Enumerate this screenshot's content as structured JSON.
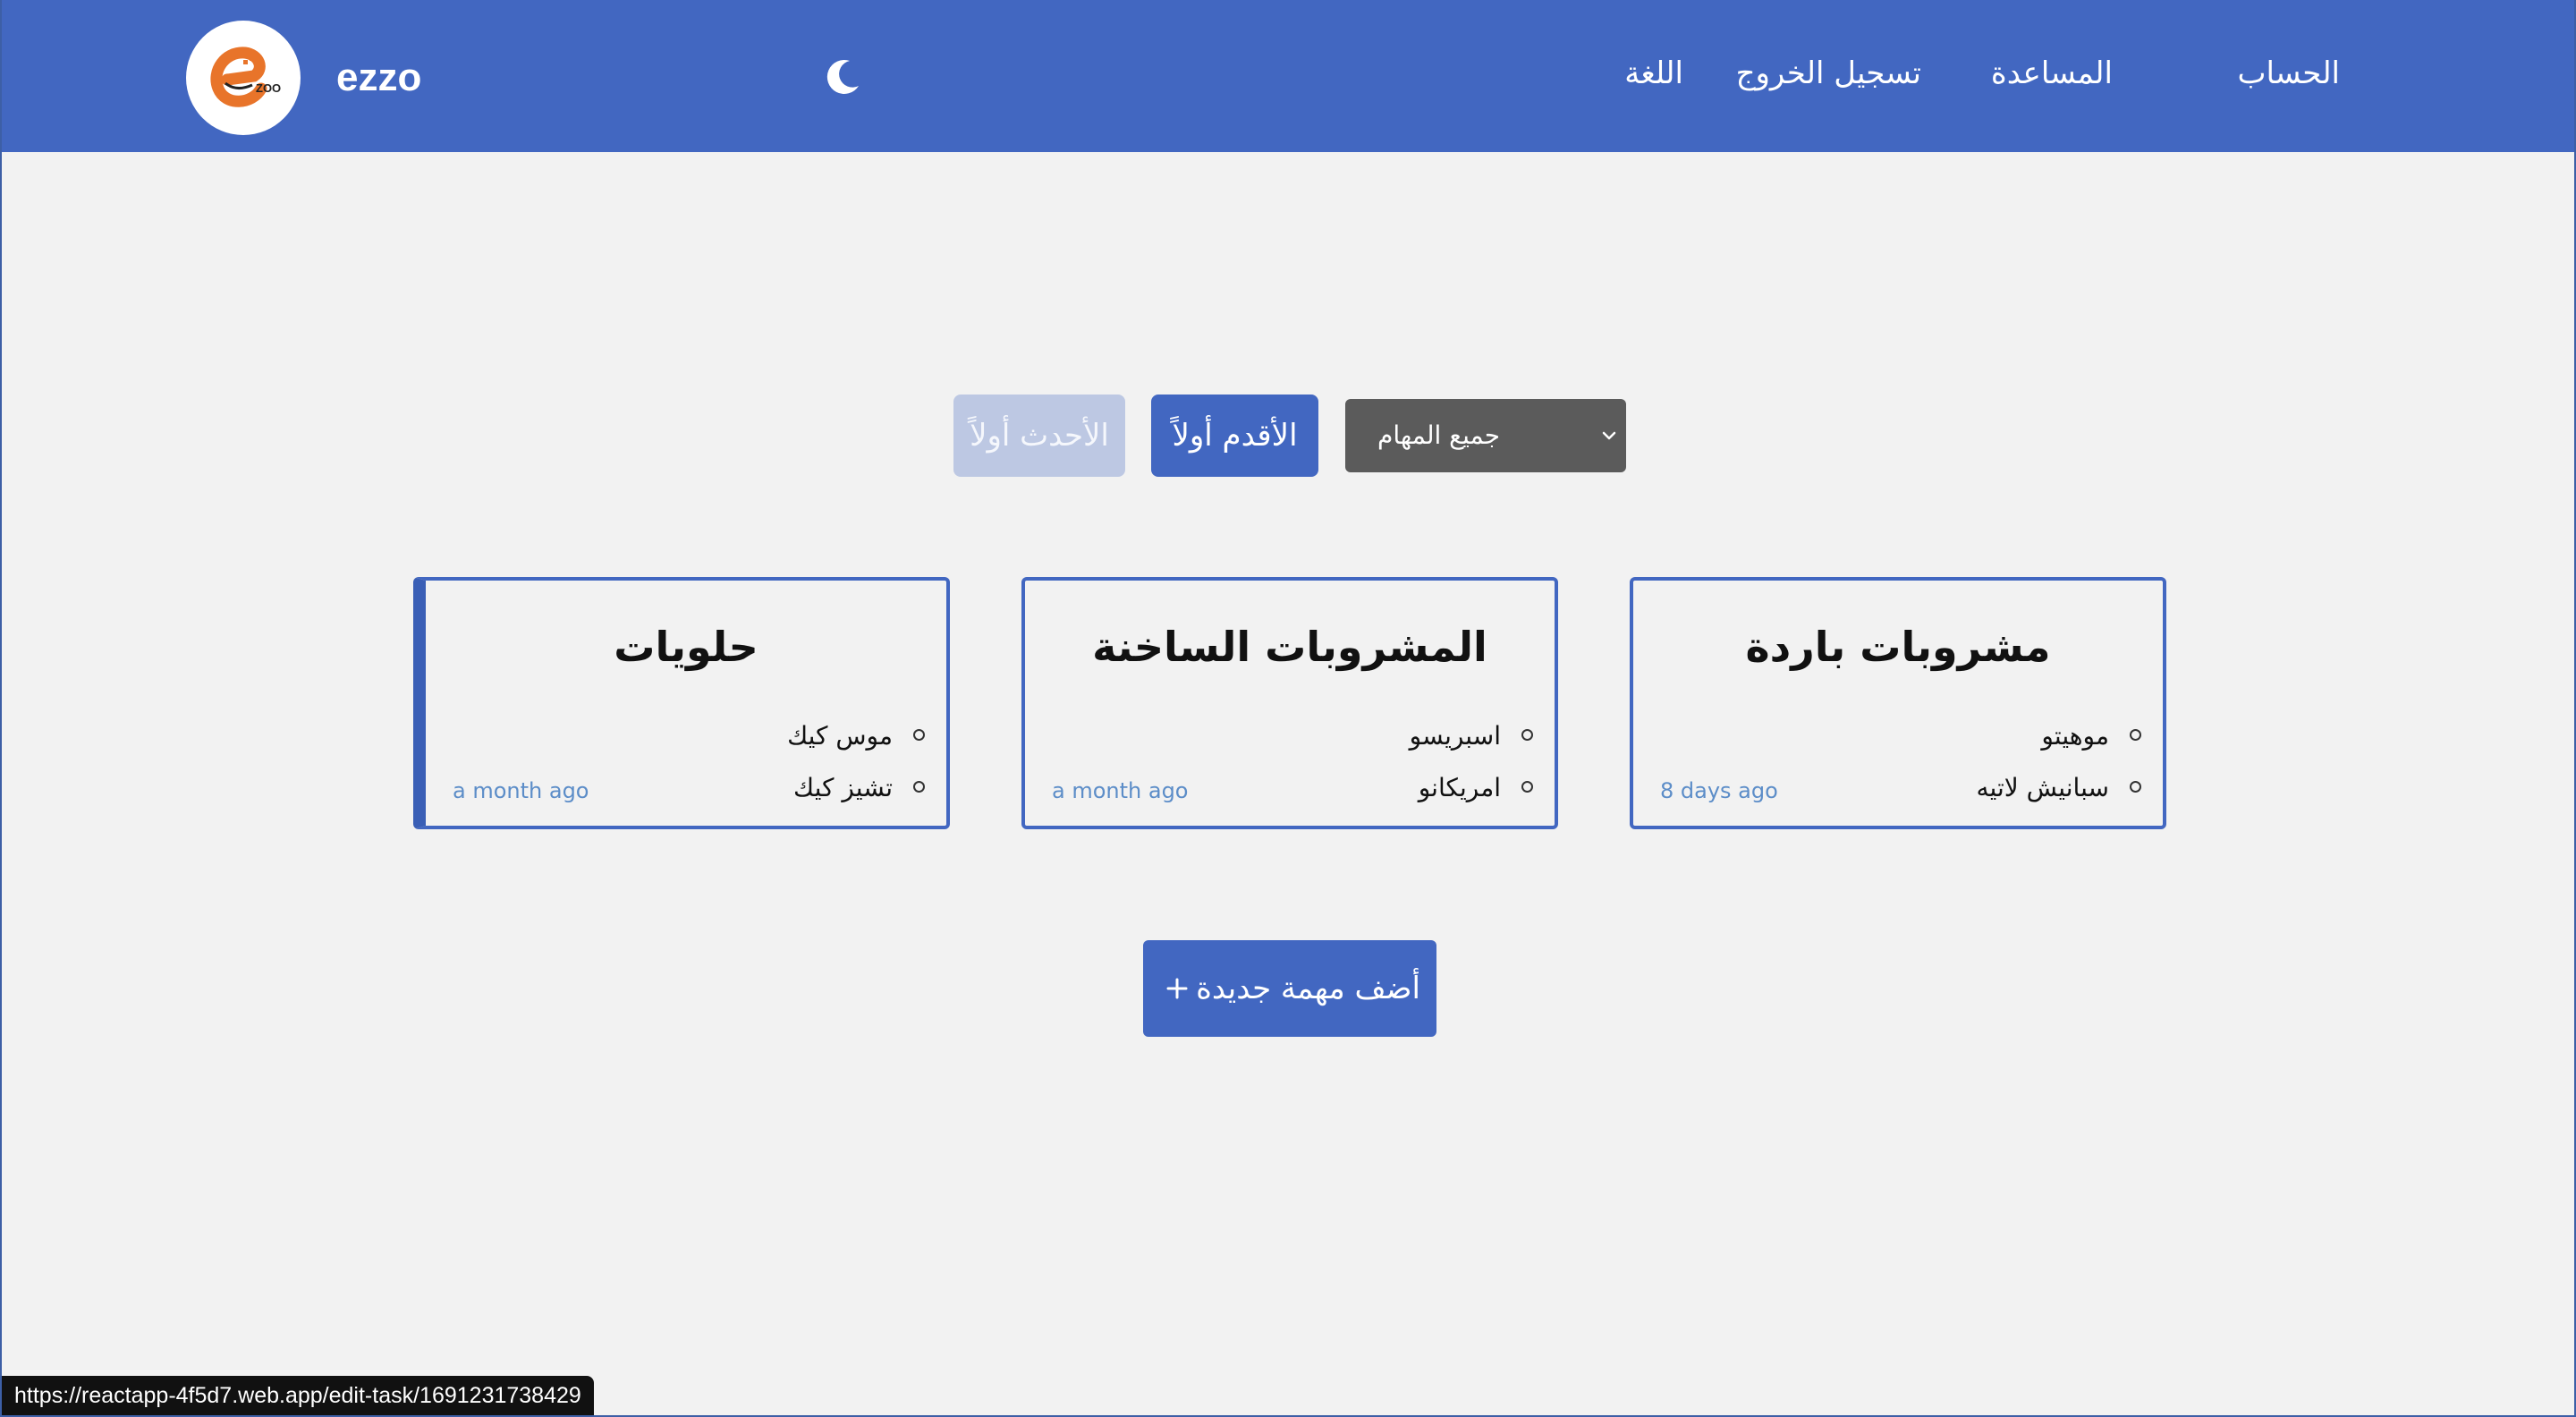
{
  "header": {
    "brand": "ezzo",
    "logo_icon": "ezoo-logo",
    "theme_toggle_icon": "moon-icon",
    "nav": {
      "account": "الحساب",
      "help": "المساعدة",
      "logout": "تسجيل الخروج",
      "language": "اللغة"
    }
  },
  "controls": {
    "newest_first": "الأحدث أولاً",
    "oldest_first": "الأقدم أولاً",
    "filter_selected": "جميع المهام"
  },
  "cards": [
    {
      "title": "مشروبات باردة",
      "items": [
        "موهيتو",
        "سبانيش لاتيه"
      ],
      "time": "8 days ago"
    },
    {
      "title": "المشروبات الساخنة",
      "items": [
        "اسبريسو",
        "امريكانو"
      ],
      "time": "a month ago"
    },
    {
      "title": "حلويات",
      "items": [
        "موس كيك",
        "تشيز كيك"
      ],
      "time": "a month ago"
    }
  ],
  "add_task": {
    "label": "أضف مهمة جديدة",
    "icon": "plus-icon"
  },
  "status_bar": {
    "url": "https://reactapp-4f5d7.web.app/edit-task/1691231738429"
  },
  "colors": {
    "primary": "#4267c1",
    "disabled": "#bdc8e3",
    "select_bg": "#5b5b5b",
    "background": "#f2f2f2",
    "time_text": "#5c8dc8",
    "logo_orange": "#e8742a"
  }
}
